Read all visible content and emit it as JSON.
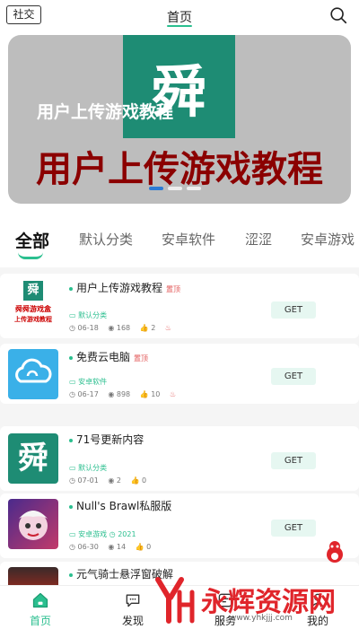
{
  "header": {
    "social_label": "社交",
    "title": "首页"
  },
  "banner": {
    "logo_char": "舜",
    "subtitle": "用户上传游戏教程",
    "main_text": "用户上传游戏教程"
  },
  "tabs": [
    "全部",
    "默认分类",
    "安卓软件",
    "涩涩",
    "安卓游戏"
  ],
  "apps": [
    {
      "name": "用户上传游戏教程",
      "badge": "置顶",
      "thumb_title": "舜舜游戏盒",
      "thumb_sub": "上传游戏教程",
      "category": "默认分类",
      "date": "06-18",
      "views": "168",
      "likes": "2",
      "action": "GET"
    },
    {
      "name": "免费云电脑",
      "badge": "置顶",
      "category": "安卓软件",
      "date": "06-17",
      "views": "898",
      "likes": "10",
      "action": "GET"
    },
    {
      "name": "71号更新内容",
      "category": "默认分类",
      "date": "07-01",
      "views": "2",
      "likes": "0",
      "action": "GET"
    },
    {
      "name": "Null's Brawl私服版",
      "category": "安卓游戏",
      "category_extra": "2021",
      "date": "06-30",
      "views": "14",
      "likes": "0",
      "action": "GET"
    },
    {
      "name": "元气骑士悬浮窗破解"
    }
  ],
  "bottom_nav": [
    {
      "label": "首页",
      "icon": "home-icon",
      "active": true
    },
    {
      "label": "发现",
      "icon": "chat-icon",
      "active": false
    },
    {
      "label": "服务",
      "icon": "service-icon",
      "active": false
    },
    {
      "label": "我的",
      "icon": "profile-icon",
      "active": false
    }
  ],
  "watermark": {
    "text": "永辉资源网",
    "url": "www.yhkjjj.com"
  },
  "colors": {
    "accent": "#2bbf8f",
    "banner_text": "#8b0000",
    "hot": "#e25555"
  }
}
